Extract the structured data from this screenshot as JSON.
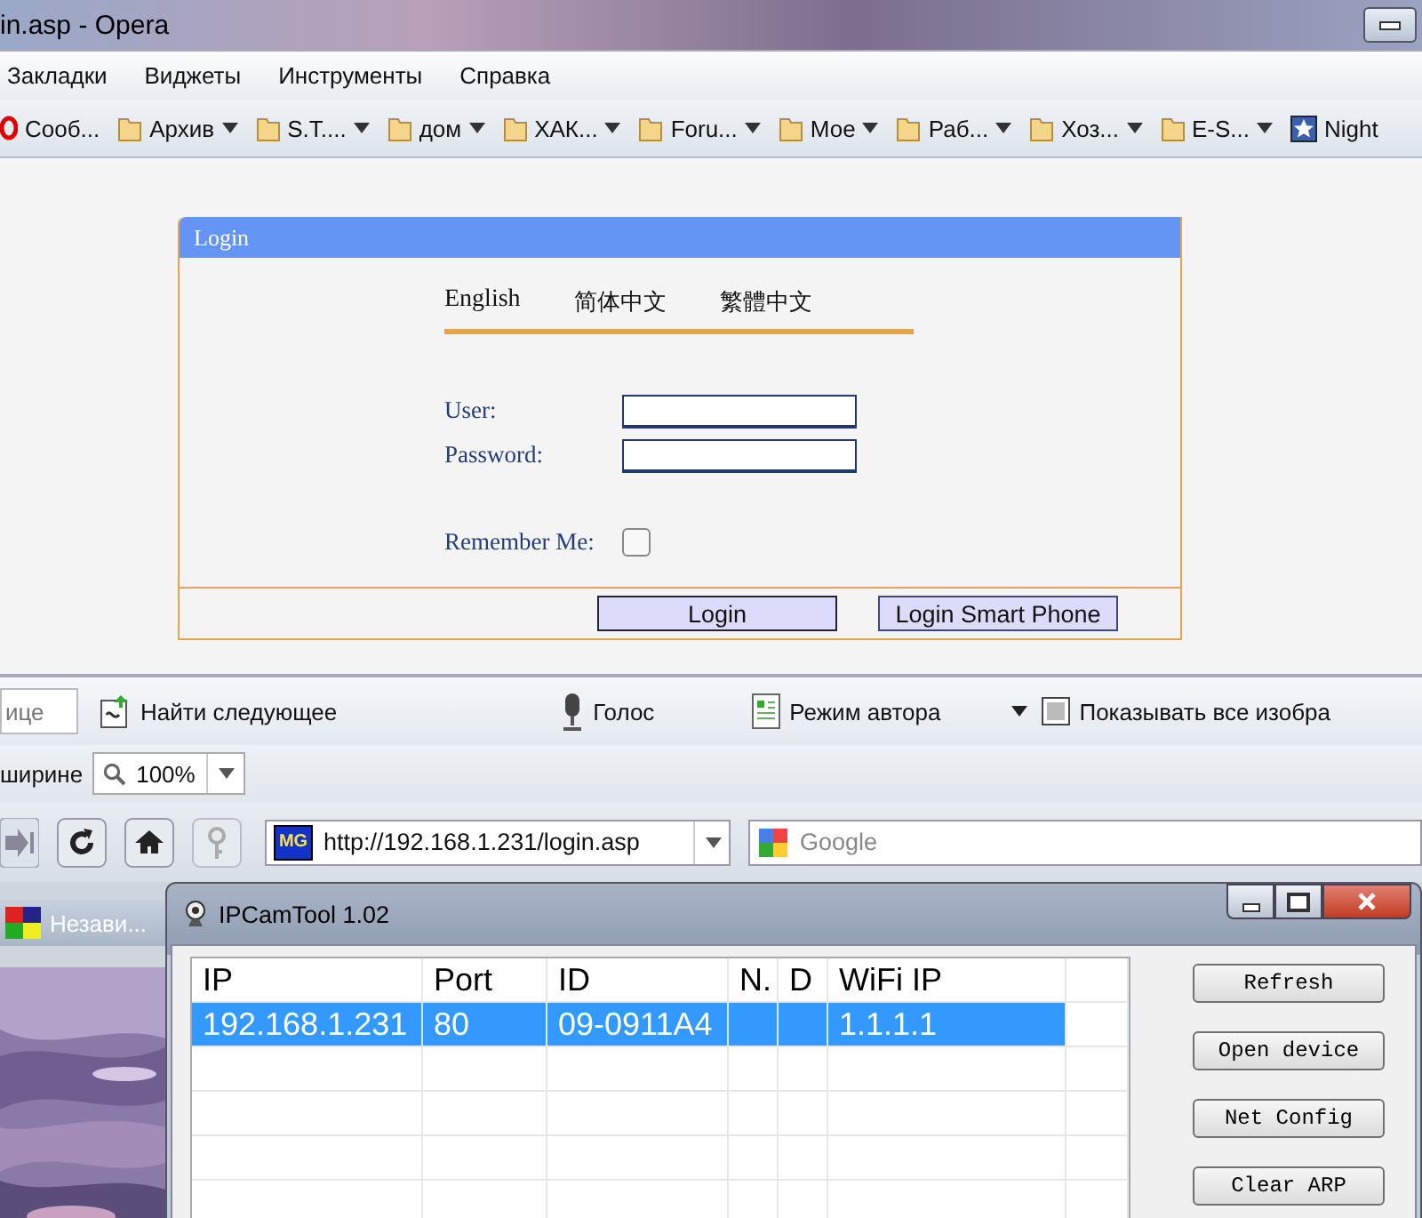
{
  "window": {
    "title": "in.asp - Opera"
  },
  "menu": [
    "Закладки",
    "Виджеты",
    "Инструменты",
    "Справка"
  ],
  "bookmarks": [
    {
      "label": "Сооб...",
      "kind": "opera",
      "dropdown": false
    },
    {
      "label": "Архив",
      "kind": "folder",
      "dropdown": true
    },
    {
      "label": "S.T....",
      "kind": "folder",
      "dropdown": true
    },
    {
      "label": "дом",
      "kind": "folder",
      "dropdown": true
    },
    {
      "label": "ХАК...",
      "kind": "folder",
      "dropdown": true
    },
    {
      "label": "Foru...",
      "kind": "folder",
      "dropdown": true
    },
    {
      "label": "Мое",
      "kind": "folder",
      "dropdown": true
    },
    {
      "label": "Раб...",
      "kind": "folder",
      "dropdown": true
    },
    {
      "label": "Хоз...",
      "kind": "folder",
      "dropdown": true
    },
    {
      "label": "E-S...",
      "kind": "folder",
      "dropdown": true
    },
    {
      "label": "Night",
      "kind": "star",
      "dropdown": false
    }
  ],
  "login_panel": {
    "title": "Login",
    "languages": [
      "English",
      "简体中文",
      "繁體中文"
    ],
    "fields": [
      {
        "label": "User:"
      },
      {
        "label": "Password:"
      }
    ],
    "remember": {
      "label": "Remember Me:",
      "checked": false
    },
    "buttons": [
      "Login",
      "Login Smart Phone"
    ]
  },
  "find_toolbar": {
    "find_value": "ице",
    "items": [
      {
        "label": "Найти следующее",
        "kind": "find"
      },
      {
        "label": "Голос",
        "kind": "voice"
      },
      {
        "label": "Режим автора",
        "kind": "author"
      },
      {
        "label": "Показывать все изобра",
        "kind": "images"
      }
    ]
  },
  "zoom_toolbar": {
    "label": "ширине",
    "zoom": "100%"
  },
  "address_bar": {
    "favicon": "MG",
    "url": "http://192.168.1.231/login.asp",
    "search_placeholder": "Google"
  },
  "tab": {
    "label": "Незави..."
  },
  "ipcamtool": {
    "title": "IPCamTool 1.02",
    "columns": [
      "IP",
      "Port",
      "ID",
      "N.",
      "D",
      "WiFi IP"
    ],
    "rows": [
      {
        "cells": [
          "192.168.1.231",
          "80",
          "09-0911A4",
          "",
          "",
          "1.1.1.1"
        ],
        "selected": true
      }
    ],
    "buttons": [
      "Refresh",
      "Open device",
      "Net Config",
      "Clear ARP"
    ]
  }
}
